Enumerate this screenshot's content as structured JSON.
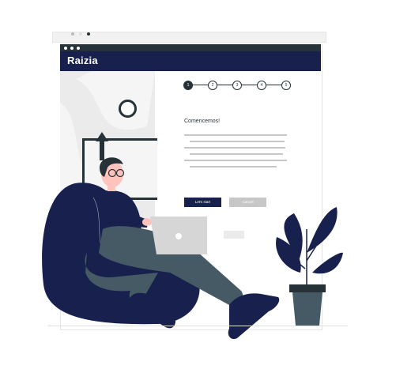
{
  "app": {
    "brand": "Raizia"
  },
  "colors": {
    "navy": "#18214d",
    "charcoal": "#263238",
    "header": "#18214d",
    "secondary_button": "#c7c7c7",
    "skin": "#ffc3bd",
    "plant": "#18214d",
    "pot": "#455a64"
  },
  "stepper": {
    "steps": [
      "1",
      "2",
      "3",
      "4",
      "5"
    ],
    "active_index": 0
  },
  "content": {
    "heading": "Comencemos!",
    "primary_button": "Let's start",
    "secondary_button": "Cancel"
  },
  "illustration": {
    "subject": "person-with-laptop",
    "seat": "bean-bag",
    "decor": "potted-plant"
  }
}
